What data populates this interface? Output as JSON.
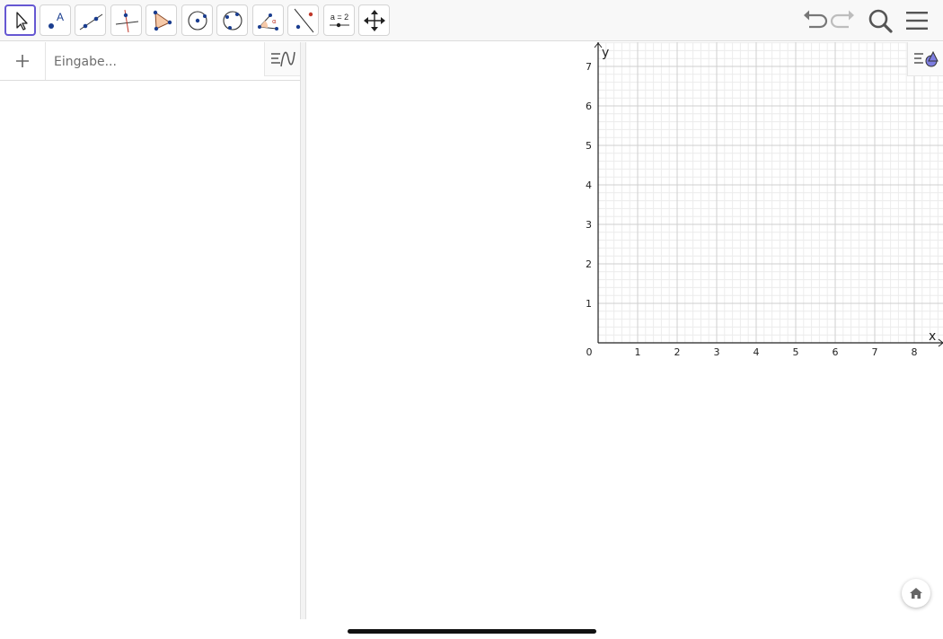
{
  "toolbar": {
    "tools": [
      {
        "name": "move",
        "icon": "arrow-cursor-icon",
        "selected": true
      },
      {
        "name": "point",
        "icon": "point-icon",
        "label": "A"
      },
      {
        "name": "line",
        "icon": "line-through-two-points-icon"
      },
      {
        "name": "perpendicular-line",
        "icon": "perpendicular-line-icon"
      },
      {
        "name": "polygon",
        "icon": "polygon-icon"
      },
      {
        "name": "circle-center-point",
        "icon": "circle-center-point-icon"
      },
      {
        "name": "circle-three-points",
        "icon": "circle-three-points-icon"
      },
      {
        "name": "angle",
        "icon": "angle-icon",
        "label": "α"
      },
      {
        "name": "reflect",
        "icon": "reflect-about-line-icon"
      },
      {
        "name": "slider",
        "icon": "slider-icon",
        "label": "a = 2"
      },
      {
        "name": "move-graphics",
        "icon": "move-graphics-view-icon"
      }
    ],
    "right_buttons": [
      "undo-icon",
      "redo-icon",
      "search-icon",
      "menu-icon"
    ]
  },
  "algebra": {
    "input_placeholder": "Eingabe...",
    "input_value": ""
  },
  "graphics": {
    "x_axis_label": "x",
    "y_axis_label": "y",
    "origin_label": "0",
    "x_ticks": [
      "1",
      "2",
      "3",
      "4",
      "5",
      "6",
      "7",
      "8"
    ],
    "y_ticks": [
      "1",
      "2",
      "3",
      "4",
      "5",
      "6",
      "7"
    ],
    "grid": true
  },
  "colors": {
    "selected_tool_border": "#6557d2",
    "point_blue": "#1a3d8f",
    "accent_red": "#c0392b",
    "grid_major": "#cfcfcf",
    "grid_minor": "#ececec"
  }
}
